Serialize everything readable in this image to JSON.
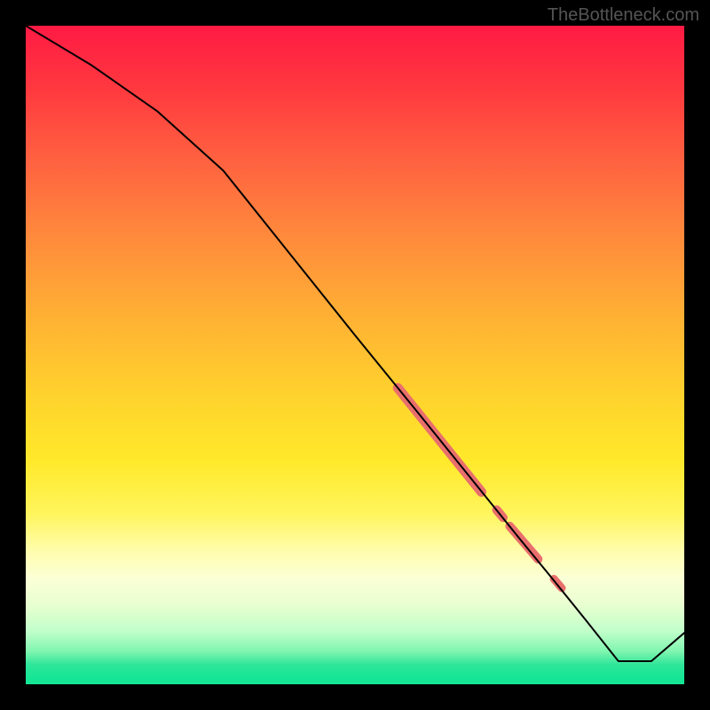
{
  "watermark_text": "TheBottleneck.com",
  "chart_data": {
    "type": "line",
    "title": "",
    "xlabel": "",
    "ylabel": "",
    "xlim": [
      0.0,
      1.0
    ],
    "ylim": [
      0.0,
      1.0
    ],
    "grid": false,
    "series": [
      {
        "name": "main-curve",
        "x": [
          0.0,
          0.1,
          0.2,
          0.3,
          0.4,
          0.5,
          0.6,
          0.65,
          0.7,
          0.75,
          0.8,
          0.85,
          0.9,
          0.95,
          1.0
        ],
        "y": [
          1.0,
          0.94,
          0.87,
          0.78,
          0.655,
          0.53,
          0.407,
          0.345,
          0.283,
          0.221,
          0.16,
          0.098,
          0.035,
          0.035,
          0.078
        ]
      }
    ],
    "highlight_segments": [
      {
        "name": "segment-a",
        "x1": 0.565,
        "y1": 0.45,
        "x2": 0.692,
        "y2": 0.292,
        "thickness": 11
      },
      {
        "name": "dot-b",
        "x1": 0.715,
        "y1": 0.265,
        "x2": 0.725,
        "y2": 0.253,
        "thickness": 10
      },
      {
        "name": "segment-c",
        "x1": 0.735,
        "y1": 0.24,
        "x2": 0.778,
        "y2": 0.19,
        "thickness": 10
      },
      {
        "name": "dot-d",
        "x1": 0.802,
        "y1": 0.16,
        "x2": 0.814,
        "y2": 0.146,
        "thickness": 9
      }
    ],
    "highlight_color": "#e96f6d",
    "line_color": "#000"
  }
}
